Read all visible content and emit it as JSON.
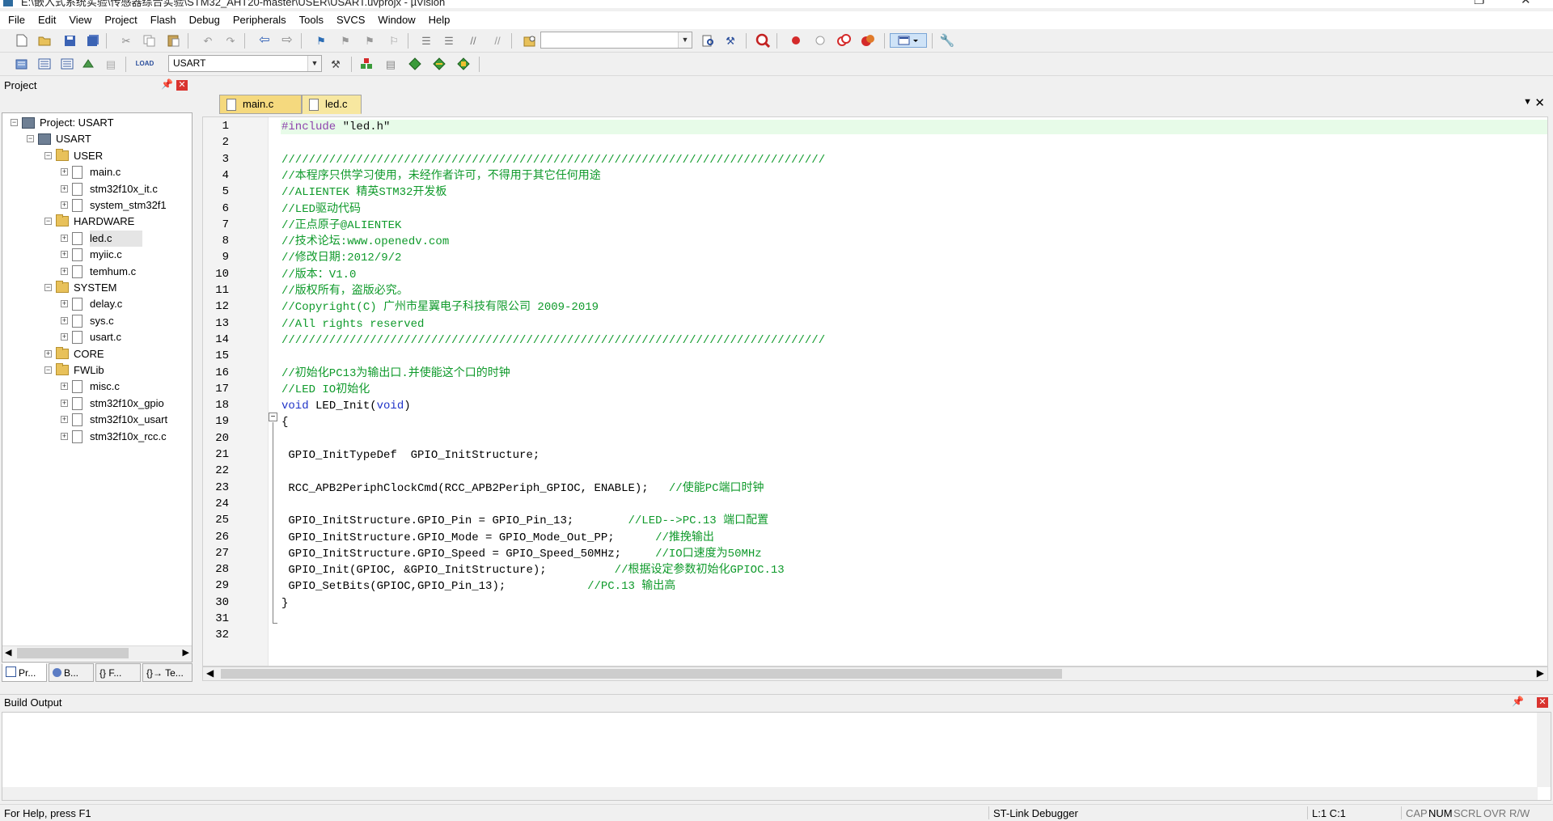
{
  "window": {
    "title": "E:\\嵌入式系统实验\\传感器综合实验\\STM32_AHT20-master\\USER\\USART.uvprojx - µVision"
  },
  "menu": [
    "File",
    "Edit",
    "View",
    "Project",
    "Flash",
    "Debug",
    "Peripherals",
    "Tools",
    "SVCS",
    "Window",
    "Help"
  ],
  "toolbar": {
    "target_name": "USART",
    "icons_row1": [
      "new-file-icon",
      "open-icon",
      "save-icon",
      "save-all-icon",
      "cut-icon",
      "copy-icon",
      "paste-icon",
      "undo-icon",
      "redo-icon",
      "nav-back-icon",
      "nav-forward-icon",
      "bookmark-icon",
      "prev-bookmark-icon",
      "next-bookmark-icon",
      "clear-bookmarks-icon",
      "indent-icon",
      "unindent-icon",
      "comment-icon",
      "uncomment-icon",
      "find-in-files-icon",
      "find-combo-dropdown-icon",
      "incremental-find-icon",
      "browse-icon",
      "debug-session-icon",
      "breakpoint-icon",
      "disable-breakpoint-icon",
      "disable-all-breakpoints-icon",
      "kill-breakpoints-icon",
      "window-layout-icon",
      "configure-icon"
    ],
    "icons_row2": [
      "translate-icon",
      "build-icon",
      "rebuild-icon",
      "batch-build-icon",
      "stop-build-icon",
      "download-icon",
      "target-options-icon",
      "manage-components-icon",
      "file-extensions-icon",
      "pack-installer-icon",
      "select-packs-icon",
      "manage-rte-icon"
    ]
  },
  "project_pane": {
    "title": "Project",
    "tree": [
      {
        "label": "Project: USART",
        "level": 0,
        "kind": "project",
        "expander": "−"
      },
      {
        "label": "USART",
        "level": 1,
        "kind": "target",
        "expander": "−"
      },
      {
        "label": "USER",
        "level": 2,
        "kind": "folder",
        "expander": "−"
      },
      {
        "label": "main.c",
        "level": 3,
        "kind": "file",
        "expander": "+"
      },
      {
        "label": "stm32f10x_it.c",
        "level": 3,
        "kind": "file",
        "expander": "+"
      },
      {
        "label": "system_stm32f1",
        "level": 3,
        "kind": "file",
        "expander": "+"
      },
      {
        "label": "HARDWARE",
        "level": 2,
        "kind": "folder",
        "expander": "−"
      },
      {
        "label": "led.c",
        "level": 3,
        "kind": "file",
        "expander": "+",
        "selected": true
      },
      {
        "label": "myiic.c",
        "level": 3,
        "kind": "file",
        "expander": "+"
      },
      {
        "label": "temhum.c",
        "level": 3,
        "kind": "file",
        "expander": "+"
      },
      {
        "label": "SYSTEM",
        "level": 2,
        "kind": "folder",
        "expander": "−"
      },
      {
        "label": "delay.c",
        "level": 3,
        "kind": "file",
        "expander": "+"
      },
      {
        "label": "sys.c",
        "level": 3,
        "kind": "file",
        "expander": "+"
      },
      {
        "label": "usart.c",
        "level": 3,
        "kind": "file",
        "expander": "+"
      },
      {
        "label": "CORE",
        "level": 2,
        "kind": "folder",
        "expander": "+"
      },
      {
        "label": "FWLib",
        "level": 2,
        "kind": "folder",
        "expander": "−"
      },
      {
        "label": "misc.c",
        "level": 3,
        "kind": "file",
        "expander": "+"
      },
      {
        "label": "stm32f10x_gpio",
        "level": 3,
        "kind": "file",
        "expander": "+"
      },
      {
        "label": "stm32f10x_usart",
        "level": 3,
        "kind": "file",
        "expander": "+"
      },
      {
        "label": "stm32f10x_rcc.c",
        "level": 3,
        "kind": "file",
        "expander": "+"
      }
    ],
    "bottom_tabs": [
      "Pr...",
      "B...",
      "{} F...",
      "{}→ Te..."
    ]
  },
  "editor": {
    "tabs": [
      {
        "label": "main.c",
        "active": false
      },
      {
        "label": "led.c",
        "active": true
      }
    ],
    "lines": [
      [
        {
          "t": "#include ",
          "c": "pp"
        },
        {
          "t": "\"led.h\"",
          "c": "str"
        }
      ],
      [],
      [
        {
          "t": "////////////////////////////////////////////////////////////////////////////////",
          "c": "cm"
        }
      ],
      [
        {
          "t": "//本程序只供学习使用，未经作者许可，不得用于其它任何用途",
          "c": "cm"
        }
      ],
      [
        {
          "t": "//ALIENTEK 精英STM32开发板",
          "c": "cm"
        }
      ],
      [
        {
          "t": "//LED驱动代码",
          "c": "cm"
        }
      ],
      [
        {
          "t": "//正点原子@ALIENTEK",
          "c": "cm"
        }
      ],
      [
        {
          "t": "//技术论坛:www.openedv.com",
          "c": "cm"
        }
      ],
      [
        {
          "t": "//修改日期:2012/9/2",
          "c": "cm"
        }
      ],
      [
        {
          "t": "//版本：V1.0",
          "c": "cm"
        }
      ],
      [
        {
          "t": "//版权所有，盗版必究。",
          "c": "cm"
        }
      ],
      [
        {
          "t": "//Copyright(C) 广州市星翼电子科技有限公司 2009-2019",
          "c": "cm"
        }
      ],
      [
        {
          "t": "//All rights reserved",
          "c": "cm"
        }
      ],
      [
        {
          "t": "////////////////////////////////////////////////////////////////////////////////",
          "c": "cm"
        }
      ],
      [],
      [
        {
          "t": "//初始化PC13为输出口.并使能这个口的时钟",
          "c": "cm"
        }
      ],
      [
        {
          "t": "//LED IO初始化",
          "c": "cm"
        }
      ],
      [
        {
          "t": "void",
          "c": "kw"
        },
        {
          "t": " LED_Init(",
          "c": "id"
        },
        {
          "t": "void",
          "c": "kw"
        },
        {
          "t": ")",
          "c": "id"
        }
      ],
      [
        {
          "t": "{",
          "c": "id"
        }
      ],
      [],
      [
        {
          "t": " GPIO_InitTypeDef  GPIO_InitStructure;",
          "c": "id"
        }
      ],
      [],
      [
        {
          "t": " RCC_APB2PeriphClockCmd(RCC_APB2Periph_GPIOC, ENABLE);   ",
          "c": "id"
        },
        {
          "t": "//使能PC端口时钟",
          "c": "cm"
        }
      ],
      [],
      [
        {
          "t": " GPIO_InitStructure.GPIO_Pin = GPIO_Pin_13;        ",
          "c": "id"
        },
        {
          "t": "//LED-->PC.13 端口配置",
          "c": "cm"
        }
      ],
      [
        {
          "t": " GPIO_InitStructure.GPIO_Mode = GPIO_Mode_Out_PP;      ",
          "c": "id"
        },
        {
          "t": "//推挽输出",
          "c": "cm"
        }
      ],
      [
        {
          "t": " GPIO_InitStructure.GPIO_Speed = GPIO_Speed_50MHz;     ",
          "c": "id"
        },
        {
          "t": "//IO口速度为50MHz",
          "c": "cm"
        }
      ],
      [
        {
          "t": " GPIO_Init(GPIOC, &GPIO_InitStructure);          ",
          "c": "id"
        },
        {
          "t": "//根据设定参数初始化GPIOC.13",
          "c": "cm"
        }
      ],
      [
        {
          "t": " GPIO_SetBits(GPIOC,GPIO_Pin_13);            ",
          "c": "id"
        },
        {
          "t": "//PC.13 输出高",
          "c": "cm"
        }
      ],
      [
        {
          "t": "}",
          "c": "id"
        }
      ],
      [],
      []
    ]
  },
  "build_output": {
    "title": "Build Output",
    "text": ""
  },
  "statusbar": {
    "help": "For Help, press F1",
    "debugger": "ST-Link Debugger",
    "position": "L:1 C:1",
    "indicators": [
      "CAP",
      "NUM",
      "SCRL",
      "OVR",
      "R/W"
    ]
  },
  "colors": {
    "comment": "#0f9a2b",
    "keyword": "#1f33c8",
    "preprocessor": "#8e44ad",
    "current_line": "#e7fbe8",
    "active_tab": "#f7e7a0"
  }
}
